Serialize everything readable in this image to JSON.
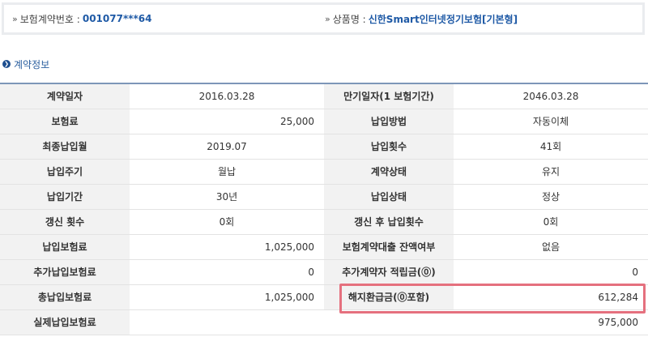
{
  "contract_info": {
    "number_label": "보험계약번호 :",
    "number_value": "001077***64",
    "product_label": "상품명 :",
    "product_value": "신한Smart인터넷정기보험[기본형]"
  },
  "section": {
    "title": "계약정보"
  },
  "rows": [
    {
      "label1": "계약일자",
      "value1": "2016.03.28",
      "label2": "만기일자(1 보험기간)",
      "value2": "2046.03.28"
    },
    {
      "label1": "보험료",
      "value1": "25,000",
      "label2": "납입방법",
      "value2": "자동이체"
    },
    {
      "label1": "최종납입월",
      "value1": "2019.07",
      "label2": "납입횟수",
      "value2": "41회"
    },
    {
      "label1": "납입주기",
      "value1": "월납",
      "label2": "계약상태",
      "value2": "유지"
    },
    {
      "label1": "납입기간",
      "value1": "30년",
      "label2": "납입상태",
      "value2": "정상"
    },
    {
      "label1": "갱신 횟수",
      "value1": "0회",
      "label2": "갱신 후 납입횟수",
      "value2": "0회"
    },
    {
      "label1": "납입보험료",
      "value1": "1,025,000",
      "label2": "보험계약대출 잔액여부",
      "value2": "없음"
    },
    {
      "label1": "추가납입보험료",
      "value1": "0",
      "label2": "추가계약자 적립금(⓪)",
      "value2": "0"
    },
    {
      "label1": "총납입보험료",
      "value1": "1,025,000",
      "label2": "해지환급금(⓪포함)",
      "value2": "612,284"
    },
    {
      "label1": "실제납입보험료",
      "value1": "",
      "label2": "",
      "value2": "975,000"
    }
  ],
  "colors": {
    "accent": "#1f5aa6",
    "header_bg": "#f2f2f2",
    "highlight": "#e5707e"
  }
}
